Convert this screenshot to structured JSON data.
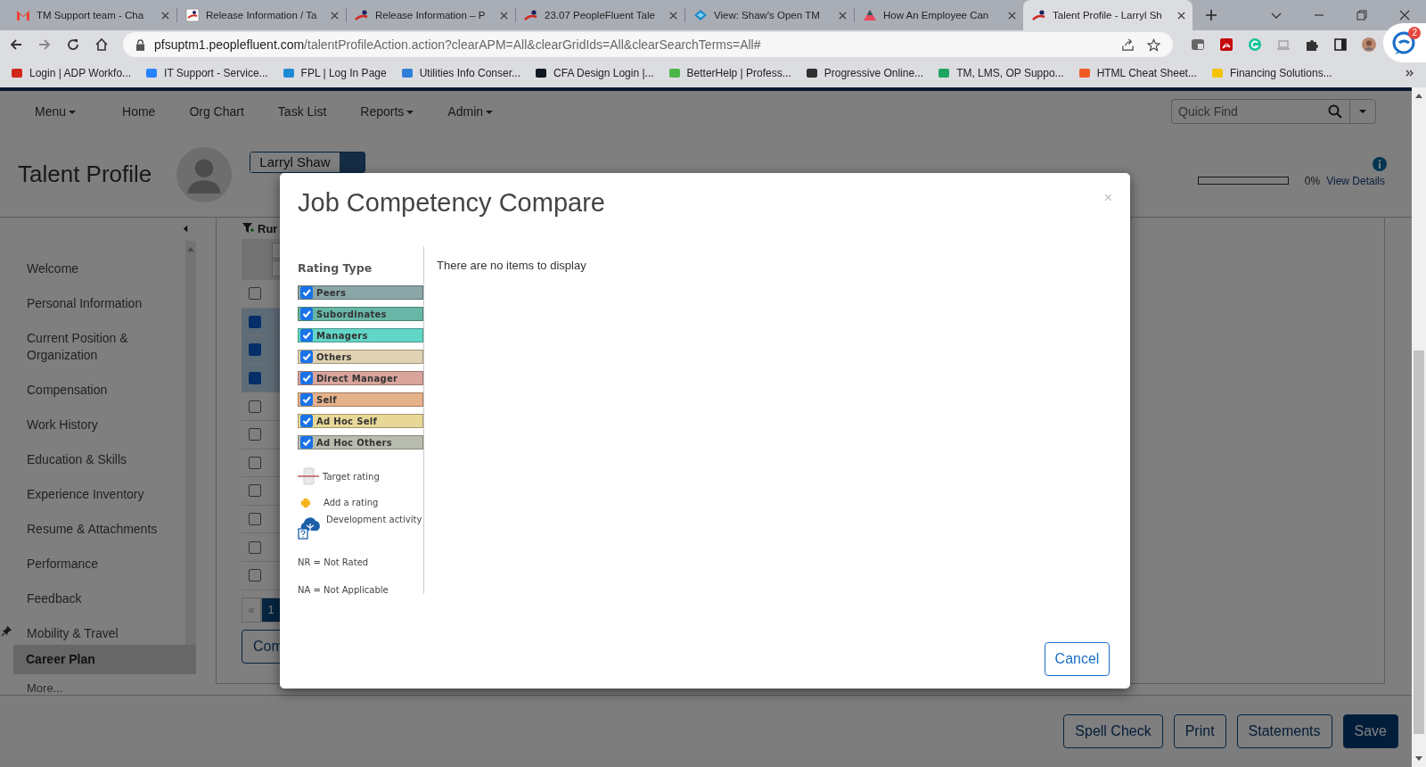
{
  "browser": {
    "tabs": [
      {
        "title": "TM Support team - Cha",
        "kind": "mail",
        "selected": false
      },
      {
        "title": "Release Information / Ta",
        "kind": "flag",
        "selected": false
      },
      {
        "title": "Release Information – P",
        "kind": "swoosh",
        "selected": false
      },
      {
        "title": "23.07 PeopleFluent Tale",
        "kind": "swoosh",
        "selected": false
      },
      {
        "title": "View: Shaw's Open TM",
        "kind": "diamond",
        "selected": false
      },
      {
        "title": "How An Employee Can",
        "kind": "triangle",
        "selected": false
      },
      {
        "title": "Talent Profile - Larryl Sh",
        "kind": "swoosh",
        "selected": true
      }
    ],
    "url_host": "pfsuptm1.peoplefluent.com",
    "url_path": "/talentProfileAction.action?clearAPM=All&clearGridIds=All&clearSearchTerms=All#",
    "bookmarks": [
      {
        "label": "Login | ADP Workfo...",
        "color": "#d0271d"
      },
      {
        "label": "IT Support - Service...",
        "color": "#2684ff"
      },
      {
        "label": "FPL | Log In Page",
        "color": "#1e8ad6"
      },
      {
        "label": "Utilities Info Conser...",
        "color": "#2f7fd8"
      },
      {
        "label": "CFA Design Login |...",
        "color": "#101820"
      },
      {
        "label": "BetterHelp | Profess...",
        "color": "#4cb748"
      },
      {
        "label": "Progressive Online...",
        "color": "#303030"
      },
      {
        "label": "TM, LMS, OP Suppo...",
        "color": "#1fa463"
      },
      {
        "label": "HTML Cheat Sheet...",
        "color": "#f05a22"
      },
      {
        "label": "Financing Solutions...",
        "color": "#f5c400"
      }
    ],
    "notification_count": "2"
  },
  "nav": {
    "items": [
      {
        "label": "Menu",
        "dropdown": true
      },
      {
        "label": "Home",
        "dropdown": false
      },
      {
        "label": "Org Chart",
        "dropdown": false
      },
      {
        "label": "Task List",
        "dropdown": false
      },
      {
        "label": "Reports",
        "dropdown": true
      },
      {
        "label": "Admin",
        "dropdown": true
      }
    ],
    "quick_find": {
      "placeholder": "Quick Find"
    }
  },
  "header": {
    "title": "Talent Profile",
    "employee": "Larryl Shaw",
    "progress": {
      "level": 0,
      "reading": "0%"
    },
    "details_link": "View Details"
  },
  "sidebar": {
    "items": [
      {
        "label": "Welcome",
        "selected": false
      },
      {
        "label": "Personal Information",
        "selected": false
      },
      {
        "label": "Current Position & Organization",
        "selected": false
      },
      {
        "label": "Compensation",
        "selected": false
      },
      {
        "label": "Work History",
        "selected": false
      },
      {
        "label": "Education & Skills",
        "selected": false
      },
      {
        "label": "Experience Inventory",
        "selected": false
      },
      {
        "label": "Resume & Attachments",
        "selected": false
      },
      {
        "label": "Performance",
        "selected": false
      },
      {
        "label": "Feedback",
        "selected": false
      },
      {
        "label": "Mobility & Travel",
        "selected": false
      }
    ],
    "pinned": {
      "label": "Career Plan",
      "selected": true
    },
    "more": "More..."
  },
  "grid": {
    "filter_label": "Rur",
    "header_checked": false,
    "rows": [
      {
        "selected": true
      },
      {
        "selected": true
      },
      {
        "selected": true
      },
      {
        "selected": false
      },
      {
        "selected": false
      },
      {
        "selected": false
      },
      {
        "selected": false
      },
      {
        "selected": false
      },
      {
        "selected": false
      },
      {
        "selected": false
      }
    ],
    "pager": [
      {
        "label": "«",
        "selected": false
      },
      {
        "label": "1",
        "selected": true
      }
    ],
    "button": "Com"
  },
  "footer_buttons": [
    {
      "label": "Spell Check",
      "primary": false
    },
    {
      "label": "Print",
      "primary": false
    },
    {
      "label": "Statements",
      "primary": false
    },
    {
      "label": "Save",
      "primary": true
    }
  ],
  "dialog": {
    "title": "Job Competency Compare",
    "close": "×",
    "legend_title": "Rating Type",
    "rating_types": [
      {
        "label": "Peers",
        "checked": true,
        "color": "#8aa6a6"
      },
      {
        "label": "Subordinates",
        "checked": true,
        "color": "#68b6a6"
      },
      {
        "label": "Managers",
        "checked": true,
        "color": "#62d6c6"
      },
      {
        "label": "Others",
        "checked": true,
        "color": "#e0d2b2"
      },
      {
        "label": "Direct Manager",
        "checked": true,
        "color": "#d8a49c"
      },
      {
        "label": "Self",
        "checked": true,
        "color": "#e6b28a"
      },
      {
        "label": "Ad Hoc Self",
        "checked": true,
        "color": "#e8d898"
      },
      {
        "label": "Ad Hoc Others",
        "checked": true,
        "color": "#b8bcae"
      }
    ],
    "legend_items": [
      {
        "kind": "target",
        "label": "Target rating"
      },
      {
        "kind": "add",
        "label": "Add a rating"
      },
      {
        "kind": "development",
        "label": "Development activity"
      }
    ],
    "notes": [
      "NR = Not Rated",
      "NA = Not Applicable"
    ],
    "empty_message": "There are no items to display",
    "cancel": "Cancel"
  }
}
